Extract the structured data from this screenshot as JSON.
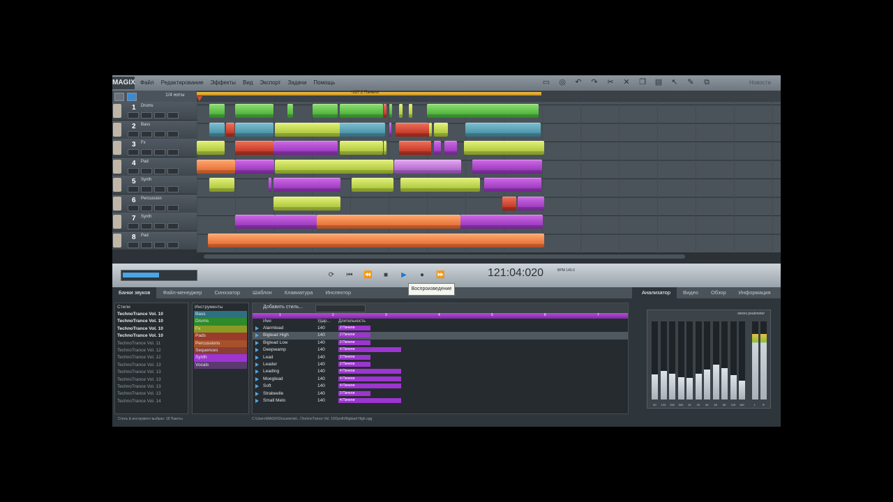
{
  "app": {
    "logo": "MAGIX",
    "menu": [
      "Файл",
      "Редактирование",
      "Эффекты",
      "Вид",
      "Экспорт",
      "Задачи",
      "Помощь"
    ],
    "new_label": "Новости"
  },
  "arranger": {
    "quantize": "1/4 ноты",
    "loop_label": "~287.2 Пачели"
  },
  "tracks": [
    {
      "num": "1",
      "name": "Drums"
    },
    {
      "num": "2",
      "name": "Bass"
    },
    {
      "num": "3",
      "name": "Fx"
    },
    {
      "num": "4",
      "name": "Pad"
    },
    {
      "num": "5",
      "name": "Synth"
    },
    {
      "num": "6",
      "name": "Percussion"
    },
    {
      "num": "7",
      "name": "Synth"
    },
    {
      "num": "8",
      "name": "Pad"
    }
  ],
  "transport": {
    "time": "121:04:020",
    "tooltip": "Воспроизведение",
    "bpm_label": "BPM\n140.0"
  },
  "lower_tabs": [
    "Банки звуков",
    "Файл-менеджер",
    "Синхзатор",
    "Шаблон",
    "Клавиатура",
    "Инспектор"
  ],
  "right_tabs": [
    "Анализатор",
    "Видео",
    "Обзор",
    "Информация"
  ],
  "styles": {
    "header": "Стили",
    "items": [
      {
        "label": "TechnoTrance Vol. 10",
        "bold": true
      },
      {
        "label": "TechnoTrance Vol. 10",
        "bold": true
      },
      {
        "label": "TechnoTrance Vol. 10",
        "bold": true
      },
      {
        "label": "TechnoTrance Vol. 10",
        "bold": true
      },
      {
        "label": "TechnoTrance Vol. 11",
        "bold": false
      },
      {
        "label": "TechnoTrance Vol. 12",
        "bold": false
      },
      {
        "label": "TechnoTrance Vol. 12",
        "bold": false
      },
      {
        "label": "TechnoTrance Vol. 13",
        "bold": false
      },
      {
        "label": "TechnoTrance Vol. 13",
        "bold": false
      },
      {
        "label": "TechnoTrance Vol. 13",
        "bold": false
      },
      {
        "label": "TechnoTrance Vol. 13",
        "bold": false
      },
      {
        "label": "TechnoTrance Vol. 13",
        "bold": false
      },
      {
        "label": "TechnoTrance Vol. 14",
        "bold": false
      }
    ]
  },
  "instruments": {
    "header": "Инструменты",
    "items": [
      {
        "label": "Bass",
        "color": "#2e6f80"
      },
      {
        "label": "Drums",
        "color": "#2f8a2a"
      },
      {
        "label": "Fx",
        "color": "#8a9a23"
      },
      {
        "label": "Pads",
        "color": "#9b3b2b"
      },
      {
        "label": "Percussions",
        "color": "#a6512a"
      },
      {
        "label": "Sequences",
        "color": "#8a3c36"
      },
      {
        "label": "Synth",
        "color": "#9d35d0"
      },
      {
        "label": "Vocals",
        "color": "#5a3a70"
      }
    ]
  },
  "loops": {
    "add_label": "Добавить стиль...",
    "col_name": "Имя",
    "col_bpm": "Удар...",
    "col_len": "Длительность",
    "bars": [
      "1",
      "2",
      "3",
      "4",
      "5",
      "6",
      "7"
    ],
    "rows": [
      {
        "name": "Alarmlead",
        "bpm": "140",
        "len": "2 Пачели",
        "len_bars": 2
      },
      {
        "name": "Biglead High",
        "bpm": "140",
        "len": "2 Пачели",
        "len_bars": 2
      },
      {
        "name": "Biglead Low",
        "bpm": "140",
        "len": "2 Пачели",
        "len_bars": 2
      },
      {
        "name": "Deepwamp",
        "bpm": "140",
        "len": "4 Пачели",
        "len_bars": 4
      },
      {
        "name": "Lead",
        "bpm": "140",
        "len": "2 Пачели",
        "len_bars": 2
      },
      {
        "name": "Leader",
        "bpm": "140",
        "len": "2 Пачели",
        "len_bars": 2
      },
      {
        "name": "Leading",
        "bpm": "140",
        "len": "4 Пачели",
        "len_bars": 4
      },
      {
        "name": "Moeglead",
        "bpm": "140",
        "len": "4 Пачели",
        "len_bars": 4
      },
      {
        "name": "Soft",
        "bpm": "140",
        "len": "4 Пачели",
        "len_bars": 4
      },
      {
        "name": "Strabeelle",
        "bpm": "140",
        "len": "2 Пачели",
        "len_bars": 2
      },
      {
        "name": "Small Melo",
        "bpm": "140",
        "len": "4 Пачели",
        "len_bars": 4
      }
    ],
    "selected_index": 1,
    "path": "C:\\Users\\MAGIX\\Documents\\...\\TechnoTrance Vol. 10\\Synth\\Biglead High.ogg"
  },
  "status": "Стиль & инструмент выбран: 18 Пакеты",
  "analyzer": {
    "label": "stereo peakmeter",
    "bands": [
      {
        "label": "60",
        "level": 0.32
      },
      {
        "label": "120",
        "level": 0.37
      },
      {
        "label": "250",
        "level": 0.33
      },
      {
        "label": "500",
        "level": 0.29
      },
      {
        "label": "1K",
        "level": 0.28
      },
      {
        "label": "2K",
        "level": 0.33
      },
      {
        "label": "4K",
        "level": 0.38
      },
      {
        "label": "6K",
        "level": 0.45
      },
      {
        "label": "8K",
        "level": 0.4
      },
      {
        "label": "12K",
        "level": 0.31
      },
      {
        "label": "16K",
        "level": 0.24
      },
      {
        "label": "L",
        "level": 0.84
      },
      {
        "label": "R",
        "level": 0.84
      }
    ]
  }
}
